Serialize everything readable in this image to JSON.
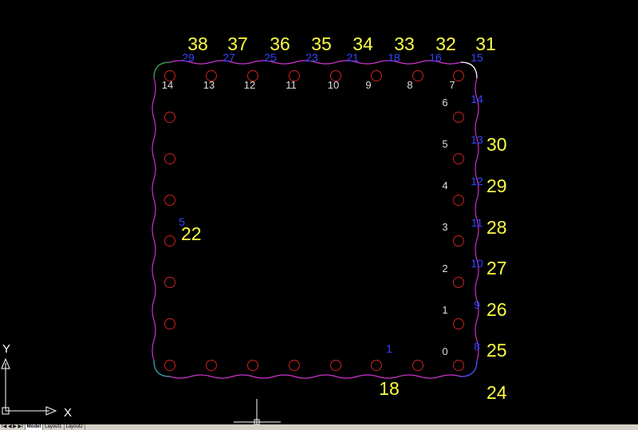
{
  "colors": {
    "background": "#000000",
    "outline": "#cc33cc",
    "outline_corner_tl": "#22aa44",
    "outline_corner_bl": "#22aaaa",
    "outline_corner_tr": "#ffffff",
    "outline_corner_br": "#3355ff",
    "hole": "#cc2222",
    "yellow_label": "#ffff44",
    "blue_label": "#3344ff",
    "pad_label": "#dddddd",
    "ucs": "#ffffff",
    "crosshair": "#ffffff"
  },
  "drawing": {
    "top_yellow": [
      "38",
      "37",
      "36",
      "35",
      "34",
      "33",
      "32",
      "31"
    ],
    "top_blue": [
      "29",
      "27",
      "25",
      "23",
      "21",
      "18",
      "16",
      "15"
    ],
    "top_pads": [
      "14",
      "13",
      "12",
      "11",
      "10",
      "9",
      "8",
      "7"
    ],
    "right_pads": [
      "6",
      "5",
      "4",
      "3",
      "2",
      "1",
      "0"
    ],
    "right_blue": [
      "14",
      "13",
      "12",
      "11",
      "10",
      "9",
      "8"
    ],
    "right_yellow": [
      "30",
      "29",
      "28",
      "27",
      "26",
      "25",
      "24"
    ],
    "left_blue": "5",
    "left_yellow": "22",
    "bottom_blue": "1",
    "bottom_yellow": "18"
  },
  "ucs": {
    "x_label": "X",
    "y_label": "Y"
  },
  "tabs": {
    "nav": "I◀ ◀ ▶ ▶I",
    "model": "Model",
    "layout1": "Layout1",
    "layout2": "Layout2"
  }
}
